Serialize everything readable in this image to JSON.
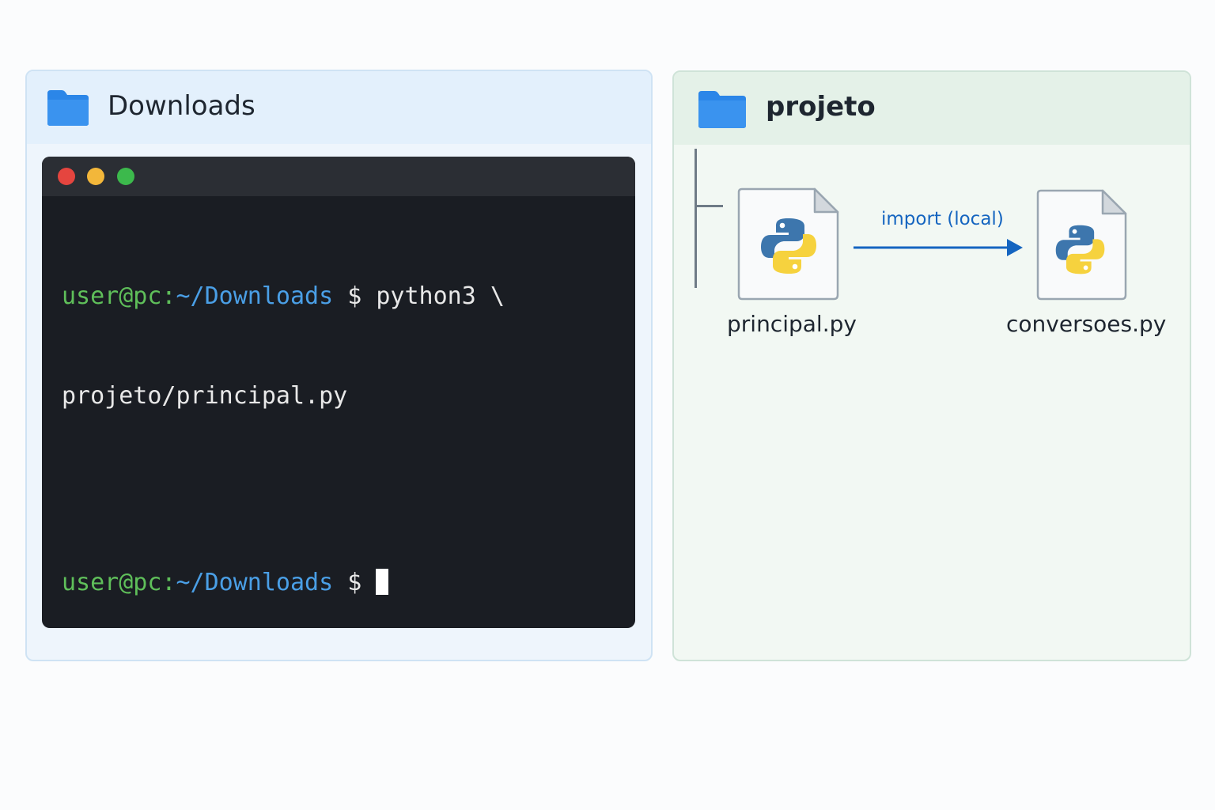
{
  "colors": {
    "folder_blue": "#2b86e8",
    "terminal_bg": "#1a1d23",
    "prompt_user": "#5fbf5a",
    "prompt_path": "#4a9fe6",
    "arrow_blue": "#1565c0",
    "python_blue": "#3d76ad",
    "python_yellow": "#f6d23e"
  },
  "left_panel": {
    "icon": "folder-icon",
    "title": "Downloads",
    "terminal": {
      "window_controls": [
        "close",
        "minimize",
        "maximize"
      ],
      "line1": {
        "prompt_user": "user@pc:",
        "prompt_path": "~/Downloads",
        "prompt_symbol": " $ ",
        "command": "python3 \\"
      },
      "line2": {
        "command": "projeto/principal.py"
      },
      "line3": {
        "prompt_user": "user@pc:",
        "prompt_path": "~/Downloads",
        "prompt_symbol": " $ "
      }
    }
  },
  "right_panel": {
    "icon": "folder-icon",
    "title": "projeto",
    "files": [
      {
        "name": "principal.py",
        "icon": "python-file-icon"
      },
      {
        "name": "conversoes.py",
        "icon": "python-file-icon"
      }
    ],
    "arrow_label": "import (local)"
  }
}
